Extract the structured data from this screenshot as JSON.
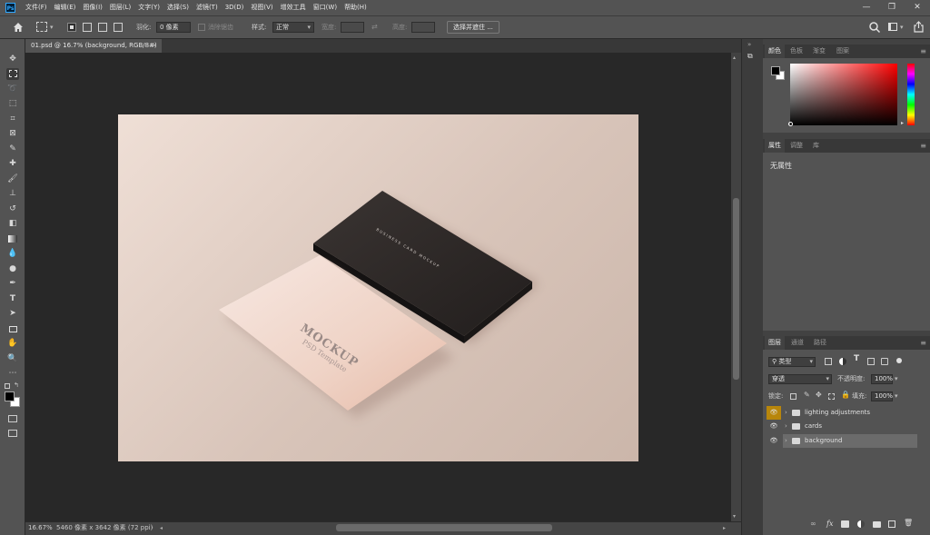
{
  "app": {
    "logo": "Ps",
    "menu": [
      "文件(F)",
      "编辑(E)",
      "图像(I)",
      "图层(L)",
      "文字(Y)",
      "选择(S)",
      "滤镜(T)",
      "3D(D)",
      "视图(V)",
      "增效工具",
      "窗口(W)",
      "帮助(H)"
    ]
  },
  "options": {
    "feather_label": "羽化:",
    "feather_value": "0 像素",
    "antialias_label": "消除锯齿",
    "style_label": "样式:",
    "style_value": "正常",
    "width_label": "宽度:",
    "height_label": "高度:",
    "select_mask_button": "选择并遮住 ..."
  },
  "document": {
    "tab_title": "01.psd @ 16.7% (background, RGB/8#)",
    "close_glyph": "×",
    "mockup_title": "MOCKUP",
    "mockup_subtitle": "PSD Template",
    "dark_card_title": "BUSINESS CARD MOCKUP"
  },
  "status": {
    "zoom": "16.67%",
    "info": "5460 像素 x 3642 像素 (72 ppi)"
  },
  "color_panel": {
    "tabs": [
      "颜色",
      "色板",
      "渐变",
      "图案"
    ],
    "active": 0
  },
  "properties_panel": {
    "tabs": [
      "属性",
      "调整",
      "库"
    ],
    "active": 0,
    "content": "无属性"
  },
  "layers_panel": {
    "tabs": [
      "图层",
      "通道",
      "路径"
    ],
    "active": 0,
    "filter_label": "类型",
    "blend_mode": "穿透",
    "opacity_label": "不透明度:",
    "opacity_value": "100%",
    "lock_label": "锁定:",
    "fill_label": "填充:",
    "fill_value": "100%",
    "layers": [
      {
        "name": "lighting adjustments",
        "selected": false
      },
      {
        "name": "cards",
        "selected": false
      },
      {
        "name": "background",
        "selected": true
      }
    ]
  },
  "colors": {
    "foreground": "#000000",
    "background": "#ffffff",
    "picker_hue": "#ff0000",
    "eye_highlight": "#b8860b"
  }
}
